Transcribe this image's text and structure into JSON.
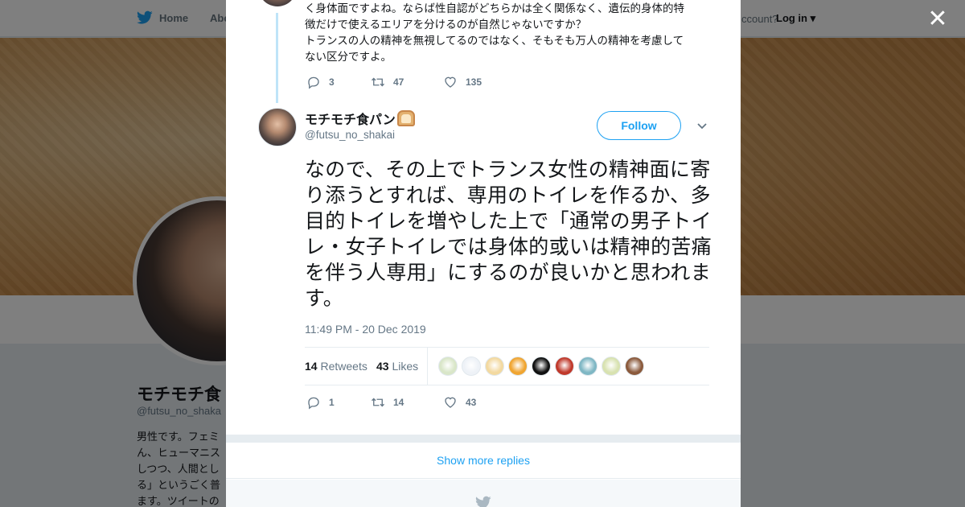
{
  "background": {
    "nav": {
      "home": "Home",
      "about": "Abo",
      "account_text": "ccount?",
      "login": "Log in"
    },
    "profile_name": "モチモチ食",
    "profile_handle": "@futsu_no_shaka",
    "bio_lines": [
      "男性です。フェミ",
      "ん、ヒューマニス",
      "しつつ、人間とし",
      "る」というごく普",
      "ます。ツイートの"
    ]
  },
  "previous_tweet": {
    "text_lines": [
      "く身体面ですよね。ならば性自認がどちらかは全く関係なく、遺伝的身体的特",
      "徴だけで使えるエリアを分けるのが自然じゃないですか？",
      "トランスの人の精神を無視してるのではなく、そもそも万人の精神を考慮して",
      "ない区分ですよ。"
    ],
    "replies": "3",
    "retweets": "47",
    "likes": "135"
  },
  "tweet": {
    "name": "モチモチ食パン",
    "name_emoji": "bread-icon",
    "handle": "@futsu_no_shakai",
    "follow_label": "Follow",
    "text": "なので、その上でトランス女性の精神面に寄り添うとすれば、専用のトイレを作るか、多目的トイレを増やした上で「通常の男子トイレ・女子トイレでは身体的或いは精神的苦痛を伴う人専用」にするのが良いかと思われます。",
    "timestamp": "11:49 PM - 20 Dec 2019",
    "retweet_count": "14",
    "retweet_label": "Retweets",
    "like_count": "43",
    "like_label": "Likes",
    "replies": "1",
    "retweets": "14",
    "likes": "43",
    "liker_colors": [
      "#d9e6c8",
      "#eef2f7",
      "#f3d9a0",
      "#f0a531",
      "#111111",
      "#c0392b",
      "#7fb7c4",
      "#d8e2b0",
      "#8b5a3c"
    ]
  },
  "show_more_replies": "Show more replies",
  "colors": {
    "accent": "#1da1f2",
    "text": "#14171a",
    "secondary": "#657786"
  }
}
